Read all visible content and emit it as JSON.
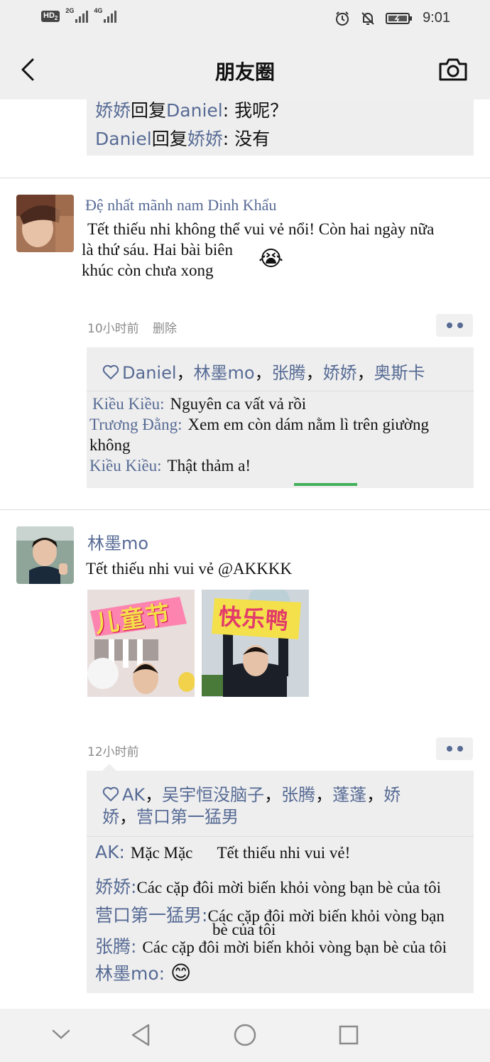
{
  "status_bar": {
    "hd_label": "HD",
    "hd_sub": "2",
    "net1": "2G",
    "net2": "4G",
    "time": "9:01"
  },
  "nav": {
    "title": "朋友圈"
  },
  "top_comments": [
    {
      "from": "娇娇",
      "verb": "回复",
      "to": "Daniel",
      "text": ": 我呢？"
    },
    {
      "from": "Daniel",
      "verb": "回复",
      "to": "娇娇",
      "text": ": 没有"
    }
  ],
  "post1": {
    "author": "Đệ nhất mãnh nam Dinh Khẩu",
    "text_line1": "Tết thiếu nhi không thể vui vẻ nổi! Còn hai ngày nữa",
    "text_line2": "là thứ sáu. Hai bài biên",
    "text_line3": "khúc còn chưa xong",
    "emoji": "😭",
    "time": "10小时前",
    "delete_label": "删除",
    "likes": [
      "Daniel",
      "林墨mo",
      "张腾",
      "娇娇",
      "奥斯卡"
    ],
    "comments": [
      {
        "name": "Kiều Kiều:",
        "text": "Nguyên ca vất vả rồi"
      },
      {
        "name": "Trương Đằng:",
        "text": "Xem em còn dám nằm lì trên giường",
        "text_cont": "không"
      },
      {
        "name": "Kiều Kiều:",
        "text": "Thật thảm a!"
      }
    ]
  },
  "post2": {
    "author": "林墨mo",
    "text": "Tết thiếu nhi vui vẻ @AKKKK",
    "photo1_caption": "儿童节",
    "photo2_caption": "快乐鸭",
    "time": "12小时前",
    "likes_line1": [
      "AK",
      "吴宇恒没脑子",
      "张腾",
      "蓬蓬",
      "娇"
    ],
    "likes_line2": [
      "娇",
      "营口第一猛男"
    ],
    "comments": [
      {
        "name": "AK:",
        "text": "Mặc Mặc      Tết thiếu nhi vui vẻ!"
      },
      {
        "name": "娇娇:",
        "text": "Các cặp đôi mời biến khỏi vòng bạn bè của tôi"
      },
      {
        "name": "营口第一猛男:",
        "text": "Các cặp đôi mời biến khỏi vòng bạn",
        "text_cont": "bè của tôi"
      },
      {
        "name": "张腾:",
        "text": "Các cặp đôi mời biến khỏi vòng bạn bè của tôi"
      },
      {
        "name": "林墨mo:",
        "text": "😊"
      }
    ]
  },
  "colors": {
    "name_blue": "#576b95",
    "comment_bg": "#eeeeee",
    "bar_bg": "#efefef"
  },
  "icons": [
    "back-arrow-icon",
    "camera-icon",
    "heart-icon",
    "more-dots-icon",
    "nav-back-triangle-icon",
    "nav-home-circle-icon",
    "nav-recents-square-icon",
    "nav-down-chevron-icon"
  ]
}
